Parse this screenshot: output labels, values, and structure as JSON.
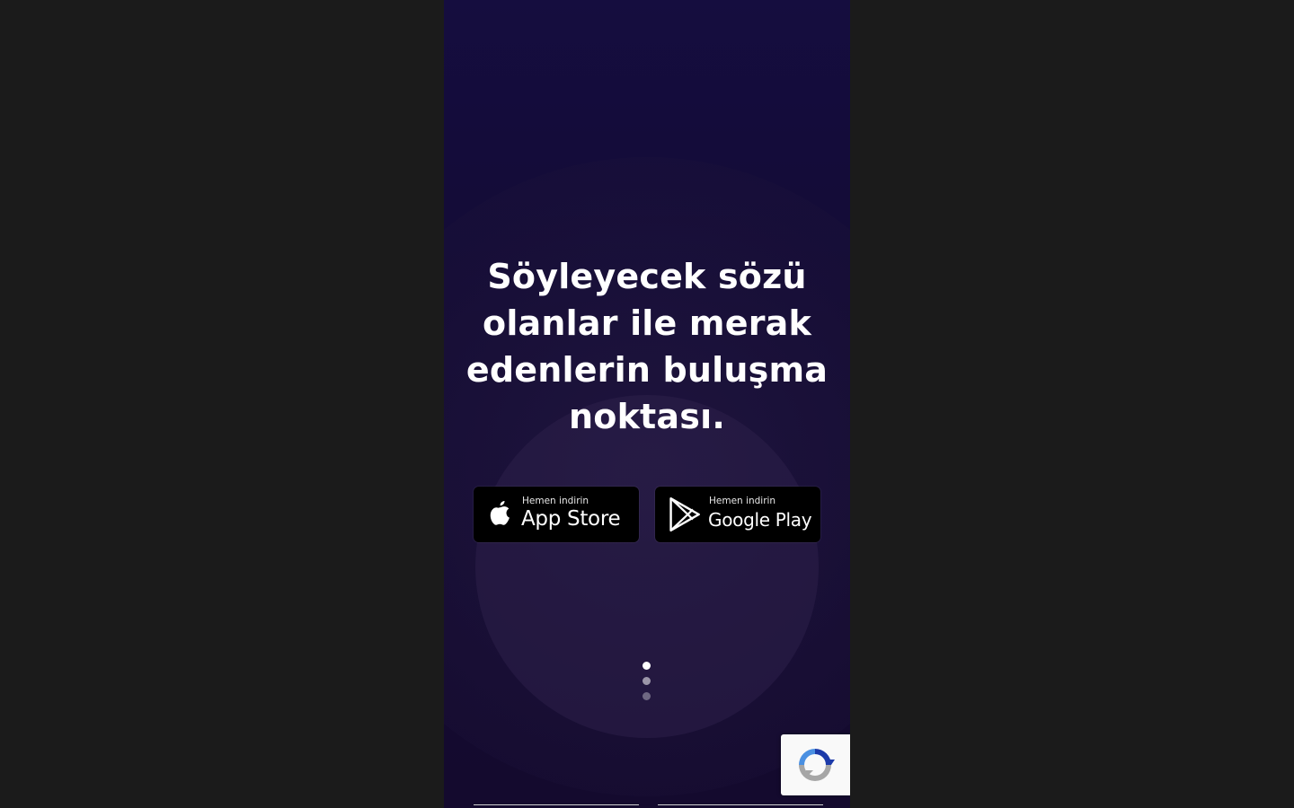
{
  "page": {
    "headline": "Söyleyecek sözü olanlar ile merak edenlerin buluşma noktası."
  },
  "stores": {
    "appstore": {
      "small_label": "Hemen indirin",
      "big_label": "App Store",
      "icon": "apple-icon"
    },
    "googleplay": {
      "small_label": "Hemen indirin",
      "big_label": "Google Play",
      "icon": "google-play-icon"
    }
  },
  "carousel": {
    "dot_count": 3,
    "active_index": 0
  },
  "colors": {
    "background": "#1b1b1b",
    "viewport_bg": "#150d3f",
    "button_bg": "#000000",
    "text": "#ffffff"
  }
}
